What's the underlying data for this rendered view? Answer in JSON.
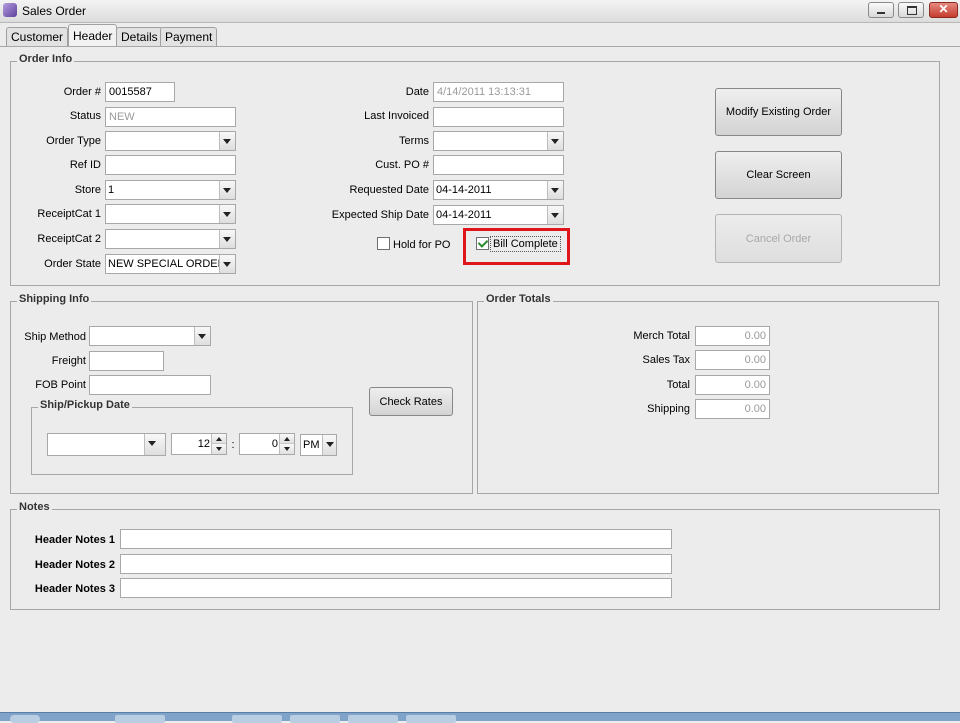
{
  "window": {
    "title": "Sales Order"
  },
  "tabs": [
    "Customer",
    "Header",
    "Details",
    "Payment"
  ],
  "order_info": {
    "legend": "Order Info",
    "order_number": {
      "label": "Order #",
      "value": "0015587"
    },
    "status": {
      "label": "Status",
      "value": "NEW"
    },
    "order_type": {
      "label": "Order Type",
      "value": ""
    },
    "ref_id": {
      "label": "Ref ID",
      "value": ""
    },
    "store": {
      "label": "Store",
      "value": "1"
    },
    "receipt_cat_1": {
      "label": "ReceiptCat 1",
      "value": ""
    },
    "receipt_cat_2": {
      "label": "ReceiptCat 2",
      "value": ""
    },
    "order_state": {
      "label": "Order State",
      "value": "NEW SPECIAL ORDER"
    },
    "date": {
      "label": "Date",
      "value": "4/14/2011 13:13:31"
    },
    "last_invoiced": {
      "label": "Last Invoiced",
      "value": ""
    },
    "terms": {
      "label": "Terms",
      "value": ""
    },
    "cust_po": {
      "label": "Cust. PO #",
      "value": ""
    },
    "requested_date": {
      "label": "Requested Date",
      "value": "04-14-2011"
    },
    "expected_ship_date": {
      "label": "Expected Ship Date",
      "value": "04-14-2011"
    },
    "hold_for_po": {
      "label": "Hold for PO",
      "checked": false
    },
    "bill_complete": {
      "label": "Bill Complete",
      "checked": true
    }
  },
  "actions": {
    "modify": "Modify Existing Order",
    "clear": "Clear Screen",
    "cancel": "Cancel Order"
  },
  "shipping_info": {
    "legend": "Shipping Info",
    "ship_method": {
      "label": "Ship Method",
      "value": ""
    },
    "freight": {
      "label": "Freight",
      "value": ""
    },
    "fob_point": {
      "label": "FOB Point",
      "value": ""
    },
    "check_rates": "Check Rates",
    "ship_pickup": {
      "legend": "Ship/Pickup Date",
      "date": "",
      "hour": "12",
      "separator": ":",
      "minute": "0",
      "ampm": "PM"
    }
  },
  "order_totals": {
    "legend": "Order Totals",
    "merch_total": {
      "label": "Merch Total",
      "value": "0.00"
    },
    "sales_tax": {
      "label": "Sales Tax",
      "value": "0.00"
    },
    "total": {
      "label": "Total",
      "value": "0.00"
    },
    "shipping": {
      "label": "Shipping",
      "value": "0.00"
    }
  },
  "notes": {
    "legend": "Notes",
    "header_notes_1": {
      "label": "Header Notes 1",
      "value": ""
    },
    "header_notes_2": {
      "label": "Header Notes 2",
      "value": ""
    },
    "header_notes_3": {
      "label": "Header Notes 3",
      "value": ""
    }
  },
  "colors": {
    "highlight": "#e0141b",
    "checkmark": "#2f8a2f"
  }
}
